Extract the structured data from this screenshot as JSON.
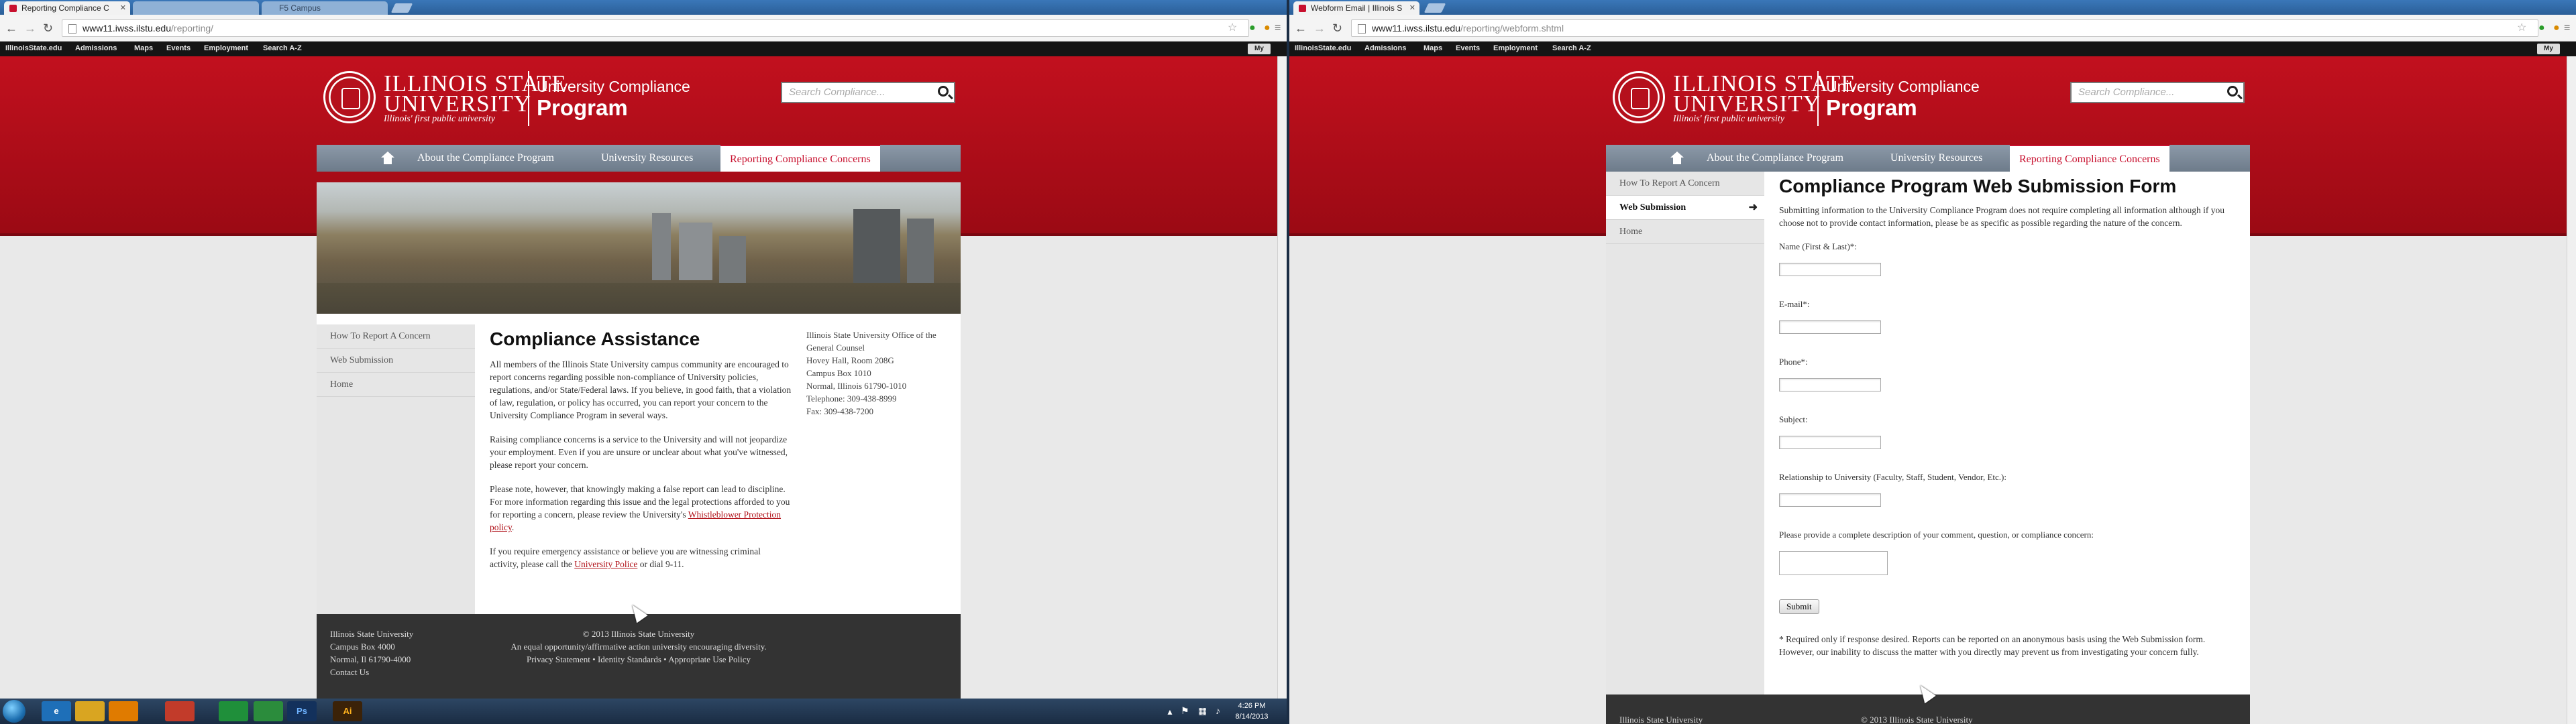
{
  "left": {
    "tabs": [
      {
        "label": "Reporting Compliance C"
      },
      {
        "label": ""
      },
      {
        "label": "F5 Campus"
      }
    ],
    "url": {
      "domain": "www11.iwss.ilstu.edu",
      "path": "/reporting/"
    }
  },
  "right": {
    "tabs": [
      {
        "label": "Webform Email | Illinois S"
      }
    ],
    "url": {
      "domain": "www11.iwss.ilstu.edu",
      "path": "/reporting/webform.shtml"
    }
  },
  "utility_links": [
    "IllinoisState.edu",
    "Admissions",
    "Maps",
    "Events",
    "Employment",
    "Search A-Z"
  ],
  "my_label": "My",
  "brand": {
    "university_line1": "ILLINOIS STATE",
    "university_line2": "UNIVERSITY",
    "tagline": "Illinois' first public university",
    "program_line1": "University Compliance",
    "program_line2": "Program",
    "search_placeholder": "Search Compliance..."
  },
  "nav": {
    "about": "About the Compliance Program",
    "resources": "University Resources",
    "reporting": "Reporting Compliance Concerns"
  },
  "sidebar": [
    "How To Report A Concern",
    "Web Submission",
    "Home"
  ],
  "assistance": {
    "title": "Compliance Assistance",
    "p1": "All members of the Illinois State University campus community are encouraged to report concerns regarding possible non-compliance of University policies, regulations, and/or State/Federal laws. If you believe, in good faith, that a violation of law, regulation, or policy has occurred, you can report your concern to the University Compliance Program in several ways.",
    "p2": "Raising compliance concerns is a service to the University and will not jeopardize your employment. Even if you are unsure or unclear about what you've witnessed, please report your concern.",
    "p3a": "Please note, however, that knowingly making a false report can lead to discipline. For more information regarding this issue and the legal protections afforded to you for reporting a concern, please review the University's ",
    "p3_link": "Whistleblower Protection policy",
    "p3b": ".",
    "p4a": "If you require emergency assistance or believe you are witnessing criminal activity, please call the ",
    "p4_link": "University Police",
    "p4b": " or dial 9-11."
  },
  "contact": [
    "Illinois State University Office of the General Counsel",
    "Hovey Hall, Room 208G",
    "Campus Box 1010",
    "Normal, Illinois 61790-1010",
    "Telephone: 309-438-8999",
    "Fax: 309-438-7200"
  ],
  "footer": {
    "addr": [
      "Illinois State University",
      "Campus Box 4000",
      "Normal, Il 61790-4000",
      "Contact Us"
    ],
    "copyright": "© 2013 Illinois State University",
    "eeo": "An equal opportunity/affirmative action university encouraging diversity.",
    "links": "Privacy Statement • Identity Standards • Appropriate Use Policy",
    "cut_left": "Illinois State University",
    "cut_center": "© 2013 Illinois State University"
  },
  "form": {
    "title": "Compliance Program Web Submission Form",
    "intro": "Submitting information to the University Compliance Program does not require completing all information although if you choose not to provide contact information, please be as specific as possible regarding the nature of the concern.",
    "name_label": "Name (First & Last)*:",
    "email_label": "E-mail*:",
    "phone_label": "Phone*:",
    "subject_label": "Subject:",
    "relationship_label": "Relationship to University (Faculty, Staff, Student, Vendor, Etc.):",
    "description_label": "Please provide a complete description of your comment, question, or compliance concern:",
    "submit": "Submit",
    "note": "* Required only if response desired. Reports can be reported on an anonymous basis using the Web Submission form. However, our inability to discuss the matter with you directly may prevent us from investigating your concern fully."
  },
  "taskbar": {
    "time": "4:26 PM",
    "date": "8/14/2013",
    "apps": [
      "",
      "e",
      "",
      "",
      "",
      "",
      "",
      "Ps",
      "Ai"
    ]
  }
}
